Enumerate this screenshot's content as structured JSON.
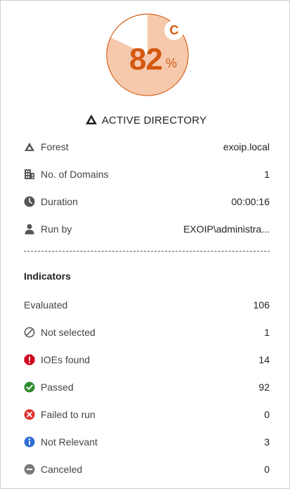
{
  "score": {
    "value": "82",
    "unit": "%",
    "grade": "C",
    "fraction": 0.82,
    "colors": {
      "fill": "#f6c9ad",
      "stroke": "#d4580f",
      "text": "#d4580f"
    }
  },
  "heading": {
    "icon": "active-directory-triangle-icon",
    "title": "ACTIVE DIRECTORY"
  },
  "details": [
    {
      "icon": "forest-icon",
      "label": "Forest",
      "value": "exoip.local"
    },
    {
      "icon": "building-icon",
      "label": "No. of Domains",
      "value": "1"
    },
    {
      "icon": "clock-icon",
      "label": "Duration",
      "value": "00:00:16"
    },
    {
      "icon": "user-icon",
      "label": "Run by",
      "value": "EXOIP\\administra..."
    }
  ],
  "indicators": {
    "title": "Indicators",
    "rows": [
      {
        "icon": "",
        "label": "Evaluated",
        "value": "106"
      },
      {
        "icon": "not-selected-icon",
        "label": "Not selected",
        "value": "1",
        "color": "#6b6b6b"
      },
      {
        "icon": "ioe-found-icon",
        "label": "IOEs found",
        "value": "14",
        "color": "#d0021b"
      },
      {
        "icon": "passed-icon",
        "label": "Passed",
        "value": "92",
        "color": "#2e8b2e"
      },
      {
        "icon": "failed-to-run-icon",
        "label": "Failed to run",
        "value": "0",
        "color": "#e03030"
      },
      {
        "icon": "not-relevant-icon",
        "label": "Not Relevant",
        "value": "3",
        "color": "#2f6fd6"
      },
      {
        "icon": "canceled-icon",
        "label": "Canceled",
        "value": "0",
        "color": "#7a7a7a"
      }
    ]
  }
}
